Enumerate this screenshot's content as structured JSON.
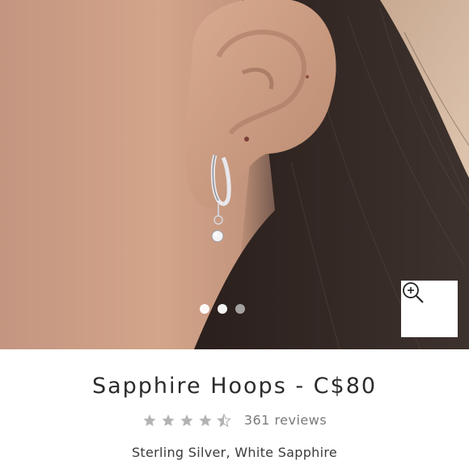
{
  "product": {
    "name_price": "Sapphire Hoops - C$80",
    "reviews_label": "361 reviews",
    "rating": 4.5,
    "rating_max": 5,
    "subtitle": "Sterling Silver, White Sapphire"
  },
  "gallery": {
    "slide_count": 3,
    "active_slides": [
      0,
      1
    ],
    "zoom_icon": "zoom-in-icon"
  },
  "colors": {
    "star": "#b3b3b3",
    "title": "#2b2b2b",
    "reviews": "#7a7a7a"
  }
}
